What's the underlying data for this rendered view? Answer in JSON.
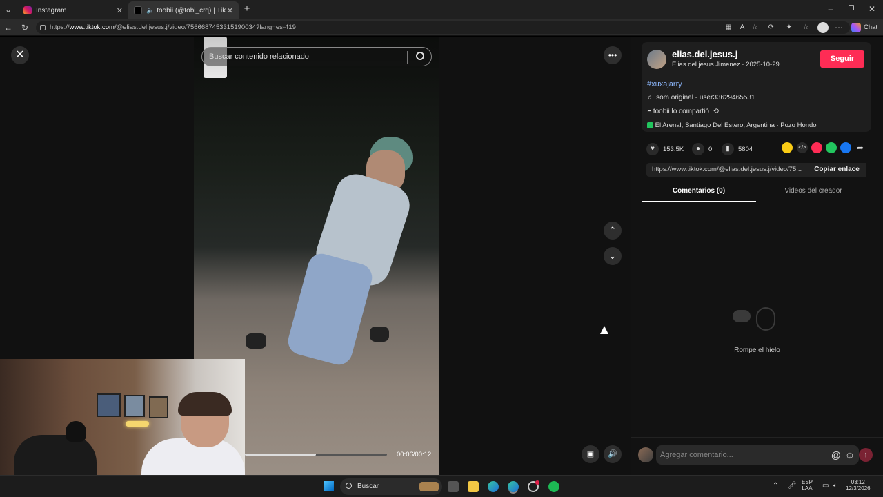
{
  "browser": {
    "tabs": [
      {
        "label": "Instagram",
        "active": false
      },
      {
        "label": "toobii (@tobi_crq) | TikTok",
        "active": true
      }
    ],
    "new_tab": "+",
    "url_prefix": "https://",
    "url_host": "www.tiktok.com",
    "url_path": "/@elias.del.jesus.j/video/7566687453315190034?lang=es-419",
    "chat_label": "Chat"
  },
  "player": {
    "search_placeholder": "Buscar contenido relacionado",
    "time": "00:06/00:12",
    "progress": 0.5
  },
  "author": {
    "username": "elias.del.jesus.j",
    "meta": "Elias del jesus Jimenez · 2025-10-29",
    "follow_label": "Seguir",
    "hashtag": "#xuxajarry",
    "sound": "som original - user33629465531",
    "shared": "toobii lo compartió",
    "location": "El Arenal, Santiago Del Estero, Argentina · Pozo Hondo"
  },
  "stats": {
    "likes": "153.5K",
    "comments": "0",
    "saves": "5804"
  },
  "link": {
    "url": "https://www.tiktok.com/@elias.del.jesus.j/video/75...",
    "copy_label": "Copiar enlace"
  },
  "tabs": {
    "comments": "Comentarios (0)",
    "creator": "Videos del creador"
  },
  "empty": {
    "text": "Rompe el hielo"
  },
  "comment_input": {
    "placeholder": "Agregar comentario..."
  },
  "taskbar": {
    "search_label": "Buscar",
    "lang": "ESP",
    "region": "LAA",
    "time": "03:12",
    "date": "12/3/2026"
  },
  "colors": {
    "accent": "#fe2c55",
    "hashtag": "#8ab4f8"
  }
}
